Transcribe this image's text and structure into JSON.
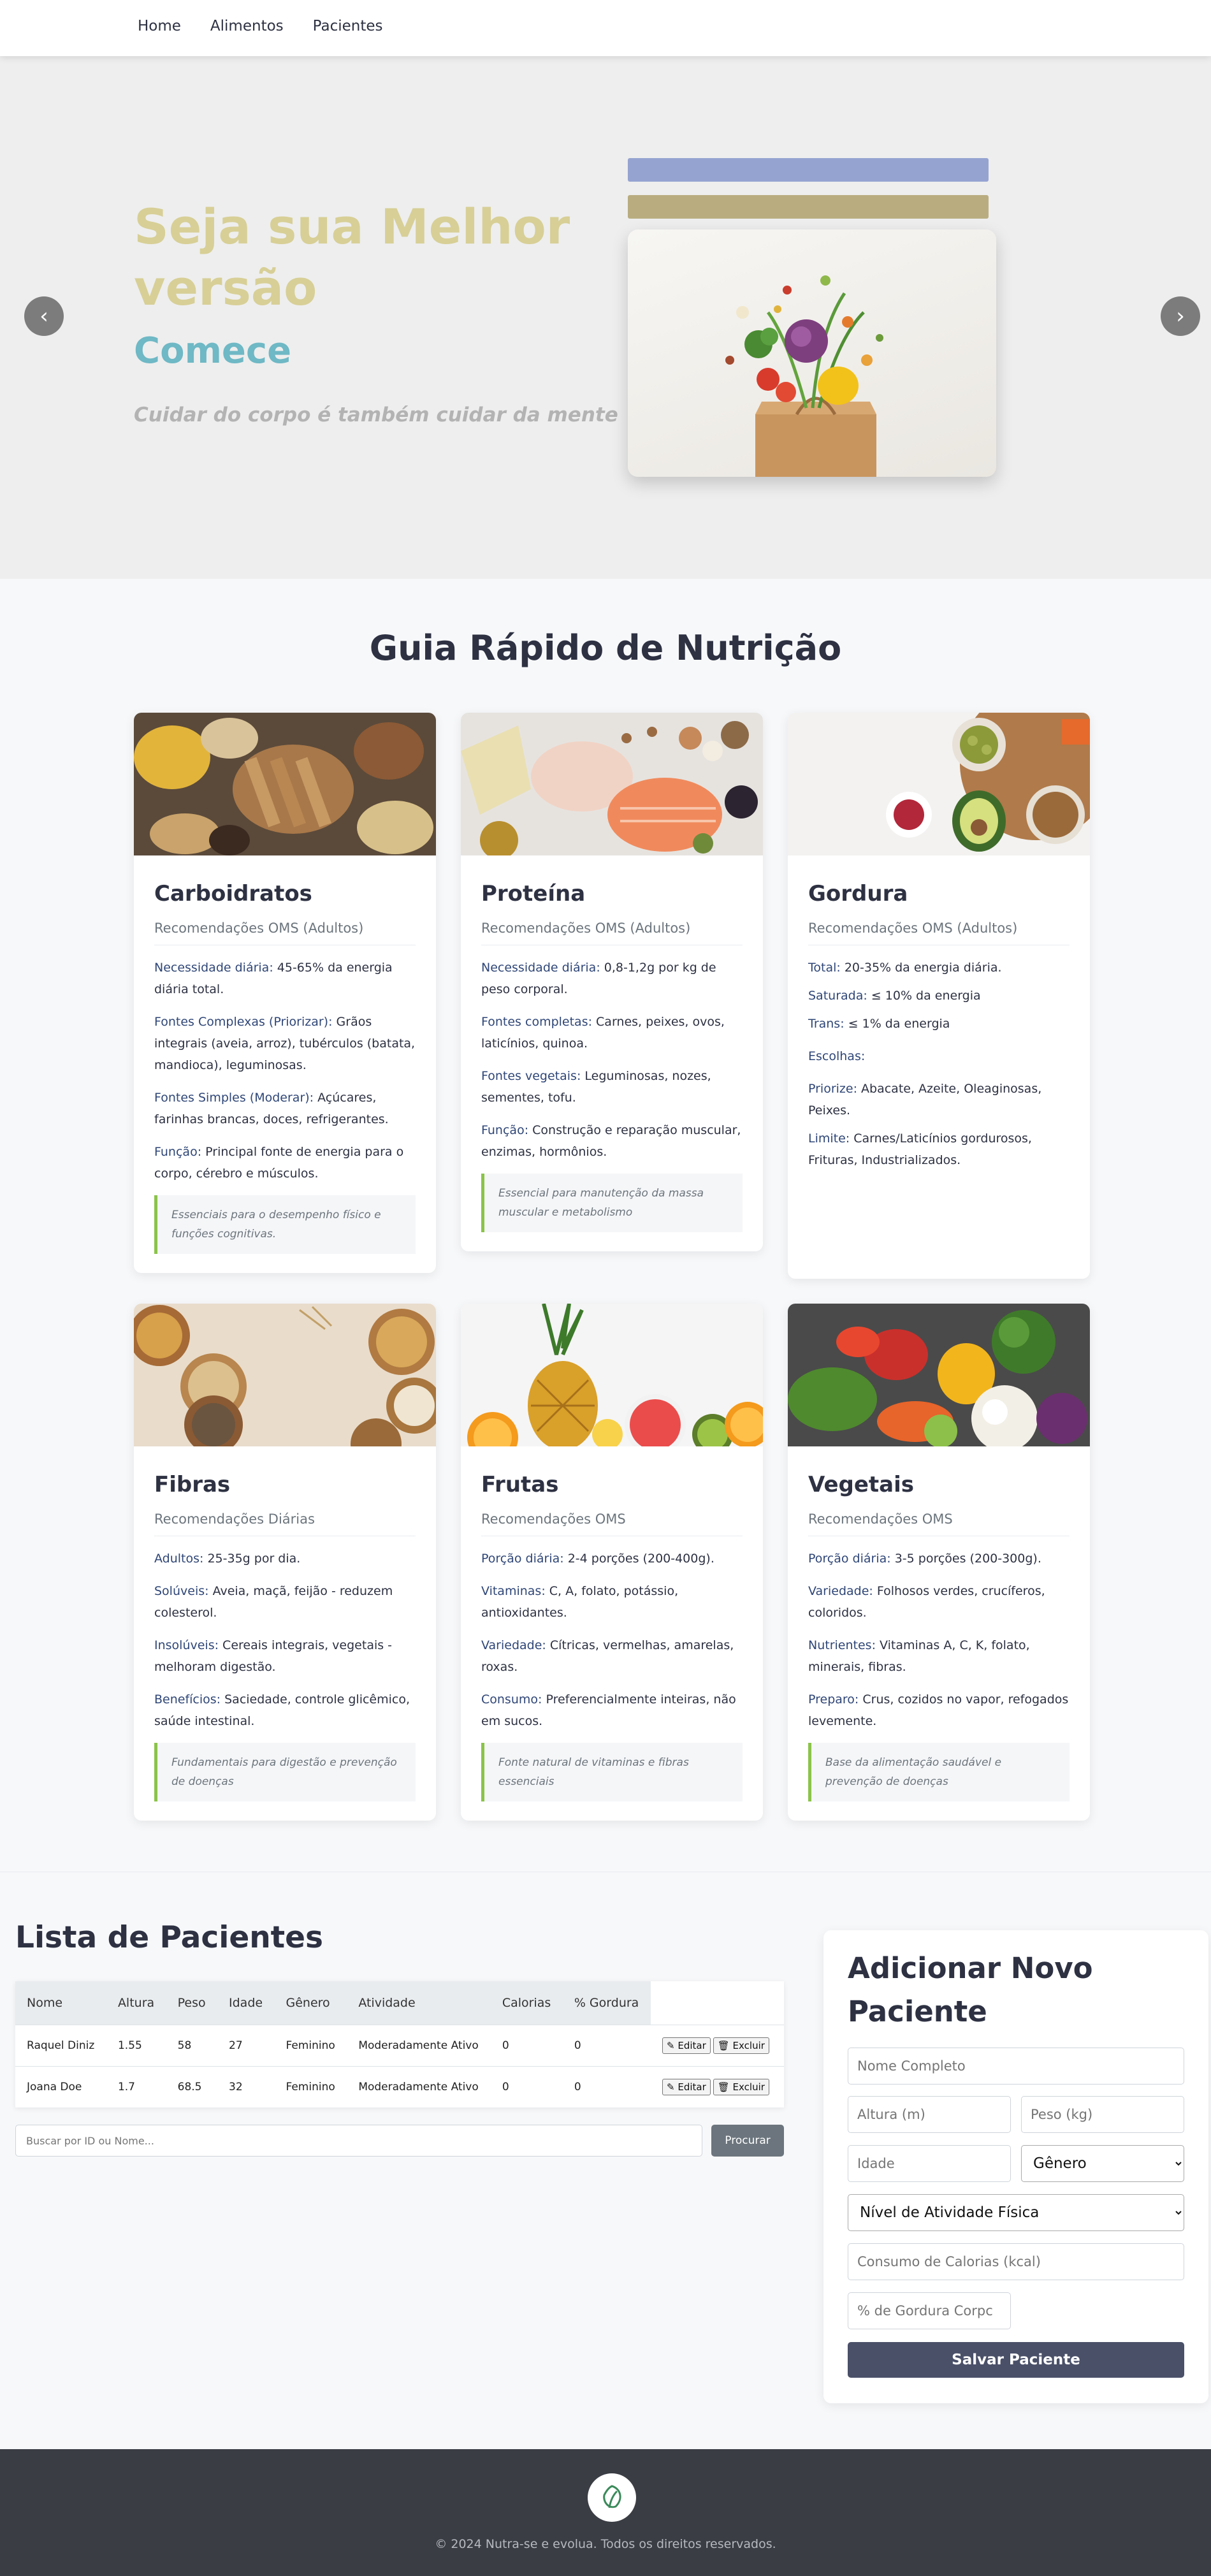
{
  "nav": {
    "items": [
      "Home",
      "Alimentos",
      "Pacientes"
    ]
  },
  "hero": {
    "title": "Seja sua Melhor versão",
    "subtitle": "Comece",
    "tagline": "Cuidar do corpo é também cuidar da mente",
    "prev_icon": "‹",
    "next_icon": "›"
  },
  "guide": {
    "title": "Guia Rápido de Nutrição",
    "cards": [
      {
        "title": "Carboidratos",
        "subtitle": "Recomendações OMS (Adultos)",
        "lines": [
          {
            "label": "Necessidade diária:",
            "text": " 45-65% da energia diária total."
          },
          {
            "label": "Fontes Complexas (Priorizar):",
            "text": " Grãos integrais (aveia, arroz), tubérculos (batata, mandioca), leguminosas."
          },
          {
            "label": "Fontes Simples (Moderar):",
            "text": " Açúcares, farinhas brancas, doces, refrigerantes."
          },
          {
            "label": "Função:",
            "text": " Principal fonte de energia para o corpo, cérebro e músculos."
          }
        ],
        "note": "Essenciais para o desempenho físico e funções cognitivas."
      },
      {
        "title": "Proteína",
        "subtitle": "Recomendações OMS (Adultos)",
        "lines": [
          {
            "label": "Necessidade diária:",
            "text": " 0,8-1,2g por kg de peso corporal."
          },
          {
            "label": "Fontes completas:",
            "text": " Carnes, peixes, ovos, laticínios, quinoa."
          },
          {
            "label": "Fontes vegetais:",
            "text": " Leguminosas, nozes, sementes, tofu."
          },
          {
            "label": "Função:",
            "text": " Construção e reparação muscular, enzimas, hormônios."
          }
        ],
        "note": "Essencial para manutenção da massa muscular e metabolismo"
      },
      {
        "title": "Gordura",
        "subtitle": "Recomendações OMS (Adultos)",
        "lines": [
          {
            "label": "Total:",
            "text": " 20-35% da energia diária."
          },
          {
            "label": "Saturada:",
            "text": " ≤ 10% da energia"
          },
          {
            "label": "Trans:",
            "text": " ≤ 1% da energia"
          },
          {
            "label": "Escolhas:",
            "text": ""
          },
          {
            "label": "Priorize:",
            "text": " Abacate, Azeite, Oleaginosas, Peixes."
          },
          {
            "label": "Limite:",
            "text": " Carnes/Laticínios gordurosos, Frituras, Industrializados."
          }
        ],
        "note": ""
      },
      {
        "title": "Fibras",
        "subtitle": "Recomendações Diárias",
        "lines": [
          {
            "label": "Adultos:",
            "text": " 25-35g por dia."
          },
          {
            "label": "Solúveis:",
            "text": " Aveia, maçã, feijão - reduzem colesterol."
          },
          {
            "label": "Insolúveis:",
            "text": " Cereais integrais, vegetais - melhoram digestão."
          },
          {
            "label": "Benefícios:",
            "text": " Saciedade, controle glicêmico, saúde intestinal."
          }
        ],
        "note": "Fundamentais para digestão e prevenção de doenças"
      },
      {
        "title": "Frutas",
        "subtitle": "Recomendações OMS",
        "lines": [
          {
            "label": "Porção diária:",
            "text": " 2-4 porções (200-400g)."
          },
          {
            "label": "Vitaminas:",
            "text": " C, A, folato, potássio, antioxidantes."
          },
          {
            "label": "Variedade:",
            "text": " Cítricas, vermelhas, amarelas, roxas."
          },
          {
            "label": "Consumo:",
            "text": " Preferencialmente inteiras, não em sucos."
          }
        ],
        "note": "Fonte natural de vitaminas e fibras essenciais"
      },
      {
        "title": "Vegetais",
        "subtitle": "Recomendações OMS",
        "lines": [
          {
            "label": "Porção diária:",
            "text": " 3-5 porções (200-300g)."
          },
          {
            "label": "Variedade:",
            "text": " Folhosos verdes, crucíferos, coloridos."
          },
          {
            "label": "Nutrientes:",
            "text": " Vitaminas A, C, K, folato, minerais, fibras."
          },
          {
            "label": "Preparo:",
            "text": " Crus, cozidos no vapor, refogados levemente."
          }
        ],
        "note": "Base da alimentação saudável e prevenção de doenças"
      }
    ]
  },
  "patients": {
    "title": "Lista de Pacientes",
    "columns": [
      "Nome",
      "Altura",
      "Peso",
      "Idade",
      "Gênero",
      "Atividade",
      "Calorias",
      "% Gordura"
    ],
    "rows": [
      [
        "Raquel Diniz",
        "1.55",
        "58",
        "27",
        "Feminino",
        "Moderadamente Ativo",
        "0",
        "0"
      ],
      [
        "Joana Doe",
        "1.7",
        "68.5",
        "32",
        "Feminino",
        "Moderadamente Ativo",
        "0",
        "0"
      ]
    ],
    "edit_label": "✎ Editar",
    "delete_label": "🗑 Excluir",
    "search_placeholder": "Buscar por ID ou Nome...",
    "search_button": "Procurar"
  },
  "form": {
    "title": "Adicionar Novo Paciente",
    "name_placeholder": "Nome Completo",
    "height_placeholder": "Altura (m)",
    "weight_placeholder": "Peso (kg)",
    "age_placeholder": "Idade",
    "gender_selected": "Gênero",
    "activity_selected": "Nível de Atividade Física",
    "calories_placeholder": "Consumo de Calorias (kcal)",
    "fat_placeholder": "% de Gordura Corpc",
    "save_button": "Salvar Paciente"
  },
  "footer": {
    "text": "© 2024 Nutra-se e evolua. Todos os direitos reservados."
  },
  "colors": {
    "hero_title": "#d7cf96",
    "hero_subtitle": "#6fb8c5",
    "note_border": "#8bc34a",
    "save_button": "#4a5068",
    "footer_bg": "#3a3d44"
  }
}
